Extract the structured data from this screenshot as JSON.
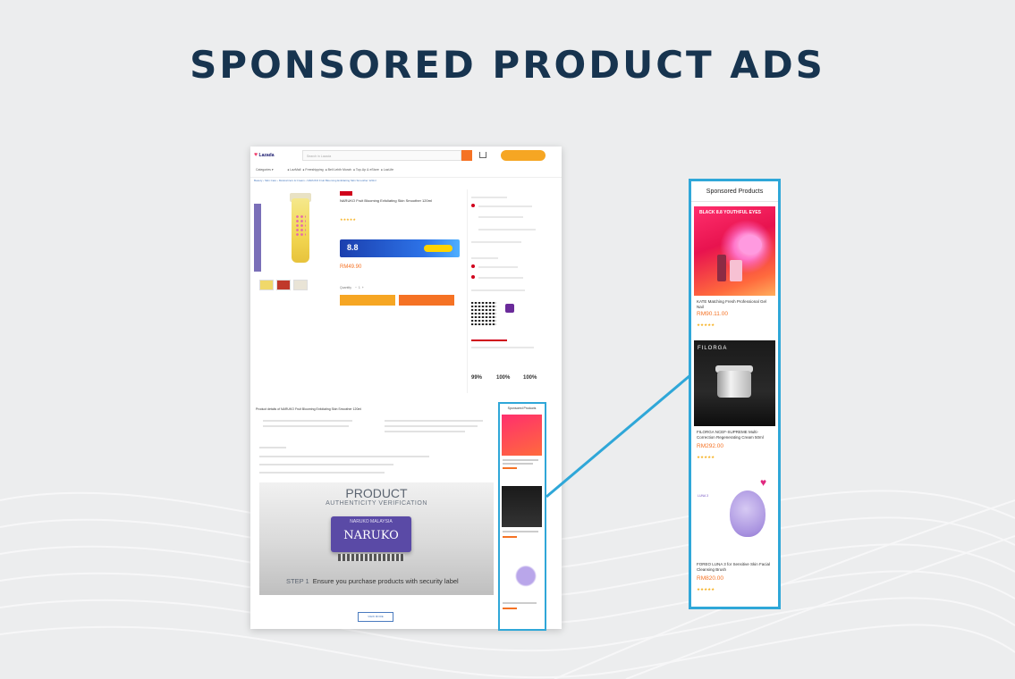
{
  "slide": {
    "title": "SPONSORED PRODUCT ADS"
  },
  "page_mock": {
    "search_placeholder": "Search in Lazada",
    "view_more_label": "VIEW MORE",
    "authenticity": {
      "title": "PRODUCT",
      "subtitle": "AUTHENTICITY VERIFICATION",
      "label_top": "NARUKO MALAYSIA",
      "label_brand": "NARUKO",
      "step_prefix": "STEP 1",
      "step_text": "Ensure you purchase products with security label"
    },
    "stats": [
      "99%",
      "100%",
      "100%"
    ],
    "banner_text": "8.8",
    "sponsored_title": "Sponsored Products"
  },
  "sponsored_panel": {
    "title": "Sponsored Products",
    "items": [
      {
        "name": "KATE Matching Fresh Professional Gel Nail",
        "price": "RM90.11.00",
        "stars": "★★★★★",
        "badge_text": "BLACK 8.8 YOUTHFUL EYES"
      },
      {
        "name": "FILORGA NCEF-SUPREME Multi-Correction Regenerating Cream 50ml",
        "price": "RM292.00",
        "stars": "★★★★★",
        "brand": "FILORGA"
      },
      {
        "name": "FOREO LUNA 3 for Sensitive Skin Facial Cleansing Brush",
        "price": "RM820.00",
        "stars": "★★★★★",
        "brand": "LUNA 3"
      }
    ]
  },
  "colors": {
    "title": "#17344f",
    "highlight_border": "#2fa7d8",
    "lazada_orange": "#f57224",
    "price": "#f57224"
  }
}
